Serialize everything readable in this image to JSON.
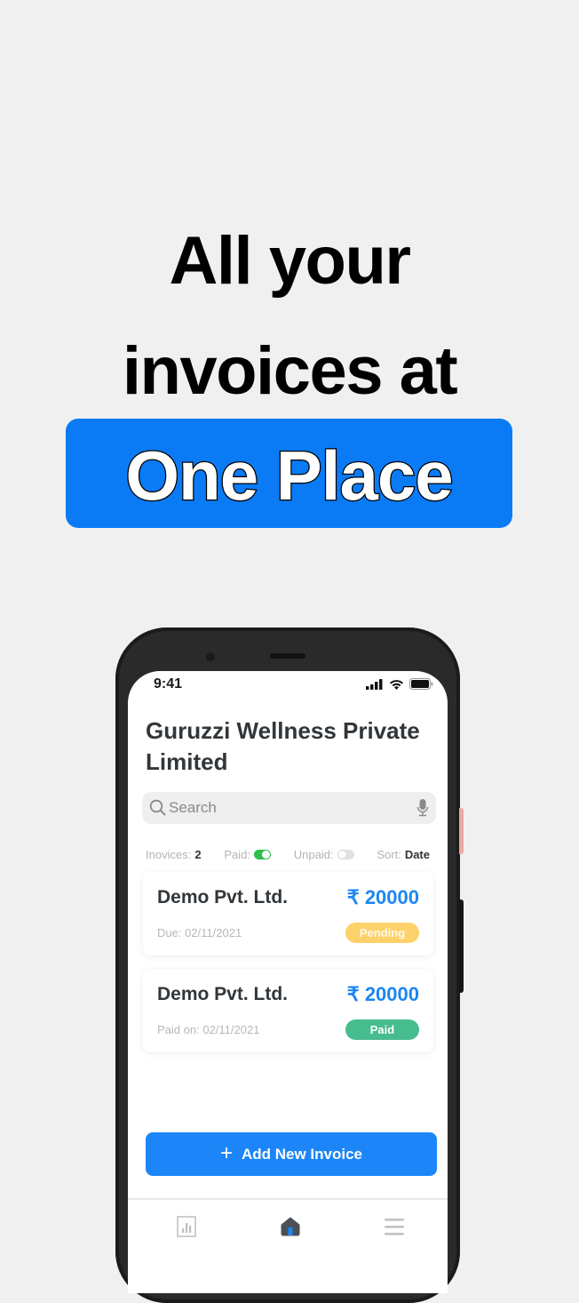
{
  "promo": {
    "headline_line1": "All your",
    "headline_line2": "invoices at",
    "highlight": "One Place",
    "highlight_color": "#0a7bf5"
  },
  "status_bar": {
    "time": "9:41",
    "icons": [
      "cellular-signal-icon",
      "wifi-icon",
      "battery-icon"
    ]
  },
  "header": {
    "company_name": "Guruzzi Wellness Private Limited"
  },
  "search": {
    "placeholder": "Search",
    "value": ""
  },
  "filters": {
    "invoices_label": "Inovices:",
    "invoices_count": "2",
    "paid_label": "Paid:",
    "paid_enabled": true,
    "unpaid_label": "Unpaid:",
    "unpaid_enabled": false,
    "sort_label": "Sort:",
    "sort_value": "Date"
  },
  "invoices": [
    {
      "client": "Demo Pvt. Ltd.",
      "amount": "₹ 20000",
      "date_text": "Due: 02/11/2021",
      "status": "Pending",
      "status_color": "#fed26a"
    },
    {
      "client": "Demo Pvt. Ltd.",
      "amount": "₹ 20000",
      "date_text": "Paid on: 02/11/2021",
      "status": "Paid",
      "status_color": "#47bc8f"
    }
  ],
  "actions": {
    "add_invoice_label": "Add New Invoice"
  },
  "tab_bar": {
    "tabs": [
      {
        "name": "reports",
        "icon": "bar-chart-icon",
        "active": false
      },
      {
        "name": "home",
        "icon": "home-icon",
        "active": true
      },
      {
        "name": "menu",
        "icon": "hamburger-menu-icon",
        "active": false
      }
    ]
  },
  "colors": {
    "accent": "#1c86f8",
    "amount": "#1c86f0",
    "background": "#f0f0f0"
  }
}
